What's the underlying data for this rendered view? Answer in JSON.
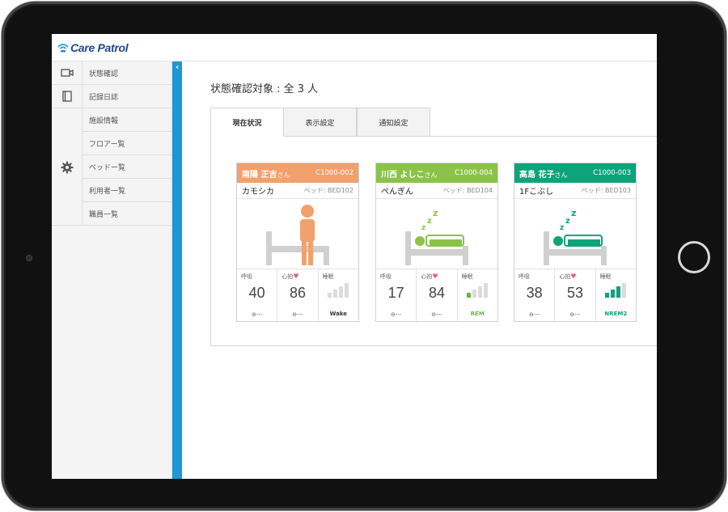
{
  "app": {
    "brand": "Care Patrol"
  },
  "sidebar": {
    "items": [
      {
        "label": "状態確認",
        "icon": "video-camera-icon"
      },
      {
        "label": "記録日誌",
        "icon": "notebook-icon"
      }
    ],
    "settings_icon": "gear-icon",
    "settings_items": [
      "施設情報",
      "フロアー覧",
      "ベッドー覧",
      "利用者一覧",
      "職員一覧"
    ],
    "collapse_icon": "chevron-left-icon"
  },
  "main": {
    "title": "状態確認対象 : 全 3 人",
    "tabs": [
      {
        "label": "現在状況",
        "active": true
      },
      {
        "label": "表示設定",
        "active": false
      },
      {
        "label": "通知設定",
        "active": false
      }
    ]
  },
  "cards": [
    {
      "name": "南陽 正吉",
      "honorific": "さん",
      "id": "C1000-002",
      "nickname": "カモシカ",
      "bed": "ベッド: BED102",
      "color": "#f2a06c",
      "state_illustration": "standing-person-icon",
      "labels": {
        "resp": "呼吸",
        "hr": "心拍",
        "sleep": "睡眠"
      },
      "resp": "40",
      "hr": "86",
      "arrow": "⊖---",
      "sleep_state": "Wake",
      "sleep_level": 0,
      "sleep_color": "#333333"
    },
    {
      "name": "川西 よしこ",
      "honorific": "さん",
      "id": "C1000-004",
      "nickname": "ぺんぎん",
      "bed": "ベッド: BED104",
      "color": "#8bc34a",
      "state_illustration": "sleeping-person-icon",
      "labels": {
        "resp": "呼吸",
        "hr": "心拍",
        "sleep": "睡眠"
      },
      "resp": "17",
      "hr": "84",
      "arrow": "⊖---",
      "sleep_state": "REM",
      "sleep_level": 1,
      "sleep_color": "#6ab445"
    },
    {
      "name": "高島 花子",
      "honorific": "さん",
      "id": "C1000-003",
      "nickname": "1Fこぶし",
      "bed": "ベッド: BED103",
      "color": "#0ea37a",
      "state_illustration": "sleeping-person-icon",
      "labels": {
        "resp": "呼吸",
        "hr": "心拍",
        "sleep": "睡眠"
      },
      "resp": "38",
      "hr": "53",
      "arrow": "⊖---",
      "sleep_state": "NREM2",
      "sleep_level": 3,
      "sleep_color": "#0ea37a"
    }
  ]
}
